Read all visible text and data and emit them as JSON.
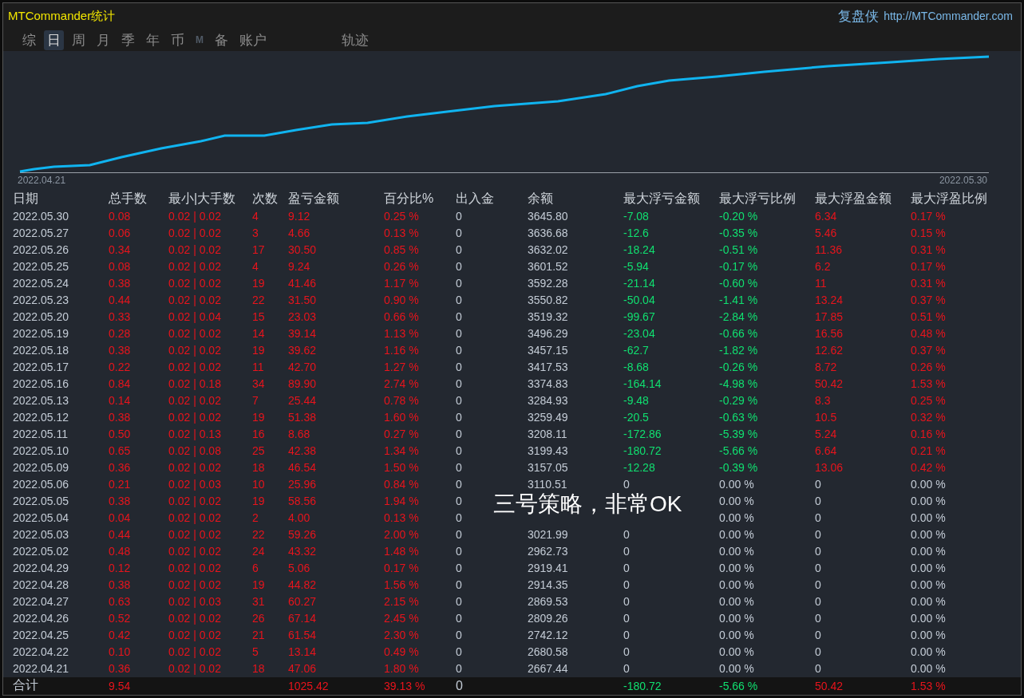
{
  "window": {
    "title": "MTCommander统计",
    "brand": "复盘侠",
    "url": "http://MTCommander.com"
  },
  "tabs": [
    {
      "label": "综",
      "selected": false,
      "disabled": false
    },
    {
      "label": "日",
      "selected": true,
      "disabled": false
    },
    {
      "label": "周",
      "selected": false,
      "disabled": false
    },
    {
      "label": "月",
      "selected": false,
      "disabled": false
    },
    {
      "label": "季",
      "selected": false,
      "disabled": false
    },
    {
      "label": "年",
      "selected": false,
      "disabled": false
    },
    {
      "label": "币",
      "selected": false,
      "disabled": false
    },
    {
      "label": "M",
      "selected": false,
      "disabled": true
    },
    {
      "label": "备",
      "selected": false,
      "disabled": false
    },
    {
      "label": "账户",
      "selected": false,
      "disabled": false
    },
    {
      "label": "轨迹",
      "selected": false,
      "disabled": false
    }
  ],
  "equity_chart": {
    "start_label": "2022.04.21",
    "end_label": "2022.05.30"
  },
  "table": {
    "columns": [
      "日期",
      "总手数",
      "最小|大手数",
      "次数",
      "盈亏金额",
      "百分比%",
      "出入金",
      "余额",
      "最大浮亏金额",
      "最大浮亏比例",
      "最大浮盈金额",
      "最大浮盈比例"
    ],
    "rows": [
      {
        "floating": true,
        "cells": [
          "2022.05.30",
          "0.08",
          "0.02 | 0.02",
          "4",
          "9.12",
          "0.25 %",
          "0",
          "3645.80",
          "-7.08",
          "-0.20 %",
          "6.34",
          "0.17 %"
        ]
      },
      {
        "floating": true,
        "cells": [
          "2022.05.27",
          "0.06",
          "0.02 | 0.02",
          "3",
          "4.66",
          "0.13 %",
          "0",
          "3636.68",
          "-12.6",
          "-0.35 %",
          "5.46",
          "0.15 %"
        ]
      },
      {
        "floating": true,
        "cells": [
          "2022.05.26",
          "0.34",
          "0.02 | 0.02",
          "17",
          "30.50",
          "0.85 %",
          "0",
          "3632.02",
          "-18.24",
          "-0.51 %",
          "11.36",
          "0.31 %"
        ]
      },
      {
        "floating": true,
        "cells": [
          "2022.05.25",
          "0.08",
          "0.02 | 0.02",
          "4",
          "9.24",
          "0.26 %",
          "0",
          "3601.52",
          "-5.94",
          "-0.17 %",
          "6.2",
          "0.17 %"
        ]
      },
      {
        "floating": true,
        "cells": [
          "2022.05.24",
          "0.38",
          "0.02 | 0.02",
          "19",
          "41.46",
          "1.17 %",
          "0",
          "3592.28",
          "-21.14",
          "-0.60 %",
          "11",
          "0.31 %"
        ]
      },
      {
        "floating": true,
        "cells": [
          "2022.05.23",
          "0.44",
          "0.02 | 0.02",
          "22",
          "31.50",
          "0.90 %",
          "0",
          "3550.82",
          "-50.04",
          "-1.41 %",
          "13.24",
          "0.37 %"
        ]
      },
      {
        "floating": true,
        "cells": [
          "2022.05.20",
          "0.33",
          "0.02 | 0.04",
          "15",
          "23.03",
          "0.66 %",
          "0",
          "3519.32",
          "-99.67",
          "-2.84 %",
          "17.85",
          "0.51 %"
        ]
      },
      {
        "floating": true,
        "cells": [
          "2022.05.19",
          "0.28",
          "0.02 | 0.02",
          "14",
          "39.14",
          "1.13 %",
          "0",
          "3496.29",
          "-23.04",
          "-0.66 %",
          "16.56",
          "0.48 %"
        ]
      },
      {
        "floating": true,
        "cells": [
          "2022.05.18",
          "0.38",
          "0.02 | 0.02",
          "19",
          "39.62",
          "1.16 %",
          "0",
          "3457.15",
          "-62.7",
          "-1.82 %",
          "12.62",
          "0.37 %"
        ]
      },
      {
        "floating": true,
        "cells": [
          "2022.05.17",
          "0.22",
          "0.02 | 0.02",
          "11",
          "42.70",
          "1.27 %",
          "0",
          "3417.53",
          "-8.68",
          "-0.26 %",
          "8.72",
          "0.26 %"
        ]
      },
      {
        "floating": true,
        "cells": [
          "2022.05.16",
          "0.84",
          "0.02 | 0.18",
          "34",
          "89.90",
          "2.74 %",
          "0",
          "3374.83",
          "-164.14",
          "-4.98 %",
          "50.42",
          "1.53 %"
        ]
      },
      {
        "floating": true,
        "cells": [
          "2022.05.13",
          "0.14",
          "0.02 | 0.02",
          "7",
          "25.44",
          "0.78 %",
          "0",
          "3284.93",
          "-9.48",
          "-0.29 %",
          "8.3",
          "0.25 %"
        ]
      },
      {
        "floating": true,
        "cells": [
          "2022.05.12",
          "0.38",
          "0.02 | 0.02",
          "19",
          "51.38",
          "1.60 %",
          "0",
          "3259.49",
          "-20.5",
          "-0.63 %",
          "10.5",
          "0.32 %"
        ]
      },
      {
        "floating": true,
        "cells": [
          "2022.05.11",
          "0.50",
          "0.02 | 0.13",
          "16",
          "8.68",
          "0.27 %",
          "0",
          "3208.11",
          "-172.86",
          "-5.39 %",
          "5.24",
          "0.16 %"
        ]
      },
      {
        "floating": true,
        "cells": [
          "2022.05.10",
          "0.65",
          "0.02 | 0.08",
          "25",
          "42.38",
          "1.34 %",
          "0",
          "3199.43",
          "-180.72",
          "-5.66 %",
          "6.64",
          "0.21 %"
        ]
      },
      {
        "floating": true,
        "cells": [
          "2022.05.09",
          "0.36",
          "0.02 | 0.02",
          "18",
          "46.54",
          "1.50 %",
          "0",
          "3157.05",
          "-12.28",
          "-0.39 %",
          "13.06",
          "0.42 %"
        ]
      },
      {
        "floating": false,
        "cells": [
          "2022.05.06",
          "0.21",
          "0.02 | 0.03",
          "10",
          "25.96",
          "0.84 %",
          "0",
          "3110.51",
          "0",
          "0.00 %",
          "0",
          "0.00 %"
        ]
      },
      {
        "floating": false,
        "cells": [
          "2022.05.05",
          "0.38",
          "0.02 | 0.02",
          "19",
          "58.56",
          "1.94 %",
          "0",
          null,
          null,
          "0.00 %",
          "0",
          "0.00 %"
        ]
      },
      {
        "floating": false,
        "cells": [
          "2022.05.04",
          "0.04",
          "0.02 | 0.02",
          "2",
          "4.00",
          "0.13 %",
          "0",
          null,
          null,
          "0.00 %",
          "0",
          "0.00 %"
        ]
      },
      {
        "floating": false,
        "cells": [
          "2022.05.03",
          "0.44",
          "0.02 | 0.02",
          "22",
          "59.26",
          "2.00 %",
          "0",
          "3021.99",
          "0",
          "0.00 %",
          "0",
          "0.00 %"
        ]
      },
      {
        "floating": false,
        "cells": [
          "2022.05.02",
          "0.48",
          "0.02 | 0.02",
          "24",
          "43.32",
          "1.48 %",
          "0",
          "2962.73",
          "0",
          "0.00 %",
          "0",
          "0.00 %"
        ]
      },
      {
        "floating": false,
        "cells": [
          "2022.04.29",
          "0.12",
          "0.02 | 0.02",
          "6",
          "5.06",
          "0.17 %",
          "0",
          "2919.41",
          "0",
          "0.00 %",
          "0",
          "0.00 %"
        ]
      },
      {
        "floating": false,
        "cells": [
          "2022.04.28",
          "0.38",
          "0.02 | 0.02",
          "19",
          "44.82",
          "1.56 %",
          "0",
          "2914.35",
          "0",
          "0.00 %",
          "0",
          "0.00 %"
        ]
      },
      {
        "floating": false,
        "cells": [
          "2022.04.27",
          "0.63",
          "0.02 | 0.03",
          "31",
          "60.27",
          "2.15 %",
          "0",
          "2869.53",
          "0",
          "0.00 %",
          "0",
          "0.00 %"
        ]
      },
      {
        "floating": false,
        "cells": [
          "2022.04.26",
          "0.52",
          "0.02 | 0.02",
          "26",
          "67.14",
          "2.45 %",
          "0",
          "2809.26",
          "0",
          "0.00 %",
          "0",
          "0.00 %"
        ]
      },
      {
        "floating": false,
        "cells": [
          "2022.04.25",
          "0.42",
          "0.02 | 0.02",
          "21",
          "61.54",
          "2.30 %",
          "0",
          "2742.12",
          "0",
          "0.00 %",
          "0",
          "0.00 %"
        ]
      },
      {
        "floating": false,
        "cells": [
          "2022.04.22",
          "0.10",
          "0.02 | 0.02",
          "5",
          "13.14",
          "0.49 %",
          "0",
          "2680.58",
          "0",
          "0.00 %",
          "0",
          "0.00 %"
        ]
      },
      {
        "floating": false,
        "cells": [
          "2022.04.21",
          "0.36",
          "0.02 | 0.02",
          "18",
          "47.06",
          "1.80 %",
          "0",
          "2667.44",
          "0",
          "0.00 %",
          "0",
          "0.00 %"
        ]
      }
    ],
    "total": {
      "label": "合计",
      "total_lots": "9.54",
      "profit": "1025.42",
      "percent": "39.13 %",
      "deposit": "0",
      "max_float_loss": "-180.72",
      "max_float_loss_pct": "-5.66 %",
      "max_float_profit": "50.42",
      "max_float_profit_pct": "1.53 %"
    }
  },
  "caption": "三号策略，非常OK"
}
